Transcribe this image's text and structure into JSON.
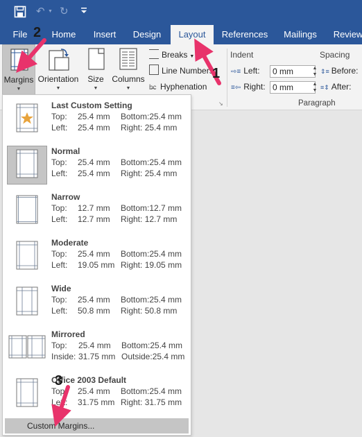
{
  "tabs": [
    "File",
    "Home",
    "Insert",
    "Design",
    "Layout",
    "References",
    "Mailings",
    "Review"
  ],
  "ribbon": {
    "margins": "Margins",
    "orientation": "Orientation",
    "size": "Size",
    "columns": "Columns",
    "breaks": "Breaks",
    "line_numbers": "Line Numbers",
    "hyphenation": "Hyphenation",
    "indent_header": "Indent",
    "spacing_header": "Spacing",
    "left_label": "Left:",
    "right_label": "Right:",
    "left_value": "0 mm",
    "right_value": "0 mm",
    "before_label": "Before:",
    "after_label": "After:",
    "paragraph_group": "Paragraph"
  },
  "margin_presets": [
    {
      "name": "Last Custom Setting",
      "k1": "Top:",
      "v1": "25.4 mm",
      "k2": "Bottom:",
      "v2": "25.4 mm",
      "k3": "Left:",
      "v3": "25.4 mm",
      "k4": "Right:",
      "v4": "25.4 mm"
    },
    {
      "name": "Normal",
      "k1": "Top:",
      "v1": "25.4 mm",
      "k2": "Bottom:",
      "v2": "25.4 mm",
      "k3": "Left:",
      "v3": "25.4 mm",
      "k4": "Right:",
      "v4": "25.4 mm"
    },
    {
      "name": "Narrow",
      "k1": "Top:",
      "v1": "12.7 mm",
      "k2": "Bottom:",
      "v2": "12.7 mm",
      "k3": "Left:",
      "v3": "12.7 mm",
      "k4": "Right:",
      "v4": "12.7 mm"
    },
    {
      "name": "Moderate",
      "k1": "Top:",
      "v1": "25.4 mm",
      "k2": "Bottom:",
      "v2": "25.4 mm",
      "k3": "Left:",
      "v3": "19.05 mm",
      "k4": "Right:",
      "v4": "19.05 mm"
    },
    {
      "name": "Wide",
      "k1": "Top:",
      "v1": "25.4 mm",
      "k2": "Bottom:",
      "v2": "25.4 mm",
      "k3": "Left:",
      "v3": "50.8 mm",
      "k4": "Right:",
      "v4": "50.8 mm"
    },
    {
      "name": "Mirrored",
      "k1": "Top:",
      "v1": "25.4 mm",
      "k2": "Bottom:",
      "v2": "25.4 mm",
      "k3": "Inside:",
      "v3": "31.75 mm",
      "k4": "Outside:",
      "v4": "25.4 mm"
    },
    {
      "name": "Office 2003 Default",
      "k1": "Top:",
      "v1": "25.4 mm",
      "k2": "Bottom:",
      "v2": "25.4 mm",
      "k3": "Left:",
      "v3": "31.75 mm",
      "k4": "Right:",
      "v4": "31.75 mm"
    }
  ],
  "custom_margins": "Custom Margins...",
  "callouts": [
    "1",
    "2",
    "3"
  ],
  "colors": {
    "accent": "#2b579a",
    "annotation": "#e8336b"
  }
}
